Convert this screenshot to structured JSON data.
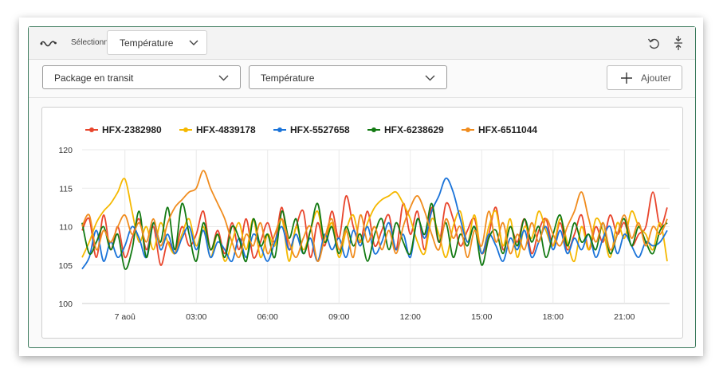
{
  "toolbar": {
    "select_label": "Sélectionner",
    "metric_value": "Température",
    "icons": [
      "wave-icon",
      "chevron-down-icon",
      "undo-icon",
      "collapse-icon"
    ]
  },
  "filters": {
    "package_value": "Package en transit",
    "metric_value": "Température",
    "add_label": "Ajouter"
  },
  "colors": {
    "panel_border": "#3b7a5c",
    "series": [
      "#e8452c",
      "#f5b800",
      "#1a73d9",
      "#137a13",
      "#f08c1e"
    ]
  },
  "chart_data": {
    "type": "line",
    "x_ticks": [
      "7 aoû",
      "03:00",
      "06:00",
      "09:00",
      "12:00",
      "15:00",
      "18:00",
      "21:00"
    ],
    "y_ticks": [
      "120",
      "115",
      "110",
      "105",
      "100"
    ],
    "ylim": [
      100,
      120
    ],
    "xlim": [
      -1.8,
      22.9
    ],
    "grid": true,
    "legend_position": "top-left",
    "series": [
      {
        "name": "HFX-2382980",
        "color": "#e8452c",
        "x": [
          -1.8,
          -1.5,
          -1.2,
          -0.9,
          -0.6,
          -0.3,
          0,
          0.3,
          0.6,
          0.9,
          1.2,
          1.5,
          1.8,
          2.1,
          2.4,
          2.7,
          3,
          3.3,
          3.6,
          3.9,
          4.2,
          4.5,
          4.8,
          5.1,
          5.4,
          5.7,
          6,
          6.3,
          6.6,
          6.9,
          7.2,
          7.5,
          7.8,
          8.1,
          8.4,
          8.7,
          9,
          9.3,
          9.6,
          9.9,
          10.2,
          10.5,
          10.8,
          11.1,
          11.4,
          11.7,
          12,
          12.3,
          12.6,
          12.9,
          13.2,
          13.5,
          13.8,
          14.1,
          14.4,
          14.7,
          15,
          15.3,
          15.6,
          15.9,
          16.2,
          16.5,
          16.8,
          17.1,
          17.4,
          17.7,
          18,
          18.3,
          18.6,
          18.9,
          19.2,
          19.5,
          19.8,
          20.1,
          20.4,
          20.7,
          21,
          21.3,
          21.6,
          21.9,
          22.2,
          22.5,
          22.8
        ],
        "y": [
          109.5,
          111,
          106,
          111.5,
          107,
          110,
          106,
          108.5,
          111,
          107,
          110,
          105,
          108,
          106.5,
          110,
          107.5,
          109,
          112,
          107,
          109.5,
          106.5,
          110.5,
          107,
          111,
          106,
          108,
          110.5,
          108,
          112.5,
          107,
          110,
          112,
          106,
          110.5,
          107.5,
          112,
          108.5,
          114,
          110,
          108,
          112,
          107.5,
          109.5,
          111.5,
          107,
          113,
          109,
          112,
          107,
          112.5,
          108,
          113,
          111,
          107.5,
          109.5,
          111,
          106.5,
          109,
          112.5,
          107,
          110,
          108,
          111,
          106.5,
          109.5,
          111,
          107.5,
          110.5,
          107,
          109,
          111.5,
          107,
          110,
          108,
          111.5,
          109,
          110.5,
          107.5,
          109,
          110,
          114.5,
          110,
          112.5
        ]
      },
      {
        "name": "HFX-4839178",
        "color": "#f5b800",
        "x": [
          -1.8,
          -1.5,
          -1.2,
          -0.9,
          -0.6,
          -0.3,
          0,
          0.3,
          0.6,
          0.9,
          1.2,
          1.5,
          1.8,
          2.1,
          2.4,
          2.7,
          3,
          3.3,
          3.6,
          3.9,
          4.2,
          4.5,
          4.8,
          5.1,
          5.4,
          5.7,
          6,
          6.3,
          6.6,
          6.9,
          7.2,
          7.5,
          7.8,
          8.1,
          8.4,
          8.7,
          9,
          9.3,
          9.6,
          9.9,
          10.2,
          10.5,
          10.8,
          11.1,
          11.4,
          11.7,
          12,
          12.3,
          12.6,
          12.9,
          13.2,
          13.5,
          13.8,
          14.1,
          14.4,
          14.7,
          15,
          15.3,
          15.6,
          15.9,
          16.2,
          16.5,
          16.8,
          17.1,
          17.4,
          17.7,
          18,
          18.3,
          18.6,
          18.9,
          19.2,
          19.5,
          19.8,
          20.1,
          20.4,
          20.7,
          21,
          21.3,
          21.6,
          21.9,
          22.2,
          22.5,
          22.8
        ],
        "y": [
          106,
          108,
          110.5,
          112,
          113,
          114.5,
          116.2,
          112,
          108,
          110,
          107,
          110.5,
          108,
          106.5,
          109,
          111,
          107.5,
          110,
          106,
          109,
          105.5,
          108,
          110.5,
          107,
          111,
          106,
          109,
          107.5,
          111,
          105.5,
          110,
          107,
          109.5,
          112,
          108,
          110.5,
          106,
          109.5,
          111.5,
          108,
          110.5,
          112.5,
          113.5,
          114,
          114.5,
          113,
          111,
          108,
          106.5,
          111,
          109,
          106,
          110,
          112,
          108,
          111.5,
          106.5,
          110,
          112,
          107.5,
          111,
          106,
          110,
          108.5,
          112,
          109.5,
          107.5,
          111,
          108,
          105.5,
          110,
          107,
          111,
          109.5,
          106,
          110.5,
          108.5,
          112,
          110,
          109,
          107,
          110.5,
          105.5
        ]
      },
      {
        "name": "HFX-5527658",
        "color": "#1a73d9",
        "x": [
          -1.8,
          -1.5,
          -1.2,
          -0.9,
          -0.6,
          -0.3,
          0,
          0.3,
          0.6,
          0.9,
          1.2,
          1.5,
          1.8,
          2.1,
          2.4,
          2.7,
          3,
          3.3,
          3.6,
          3.9,
          4.2,
          4.5,
          4.8,
          5.1,
          5.4,
          5.7,
          6,
          6.3,
          6.6,
          6.9,
          7.2,
          7.5,
          7.8,
          8.1,
          8.4,
          8.7,
          9,
          9.3,
          9.6,
          9.9,
          10.2,
          10.5,
          10.8,
          11.1,
          11.4,
          11.7,
          12,
          12.3,
          12.6,
          12.9,
          13.2,
          13.5,
          13.8,
          14.1,
          14.4,
          14.7,
          15,
          15.3,
          15.6,
          15.9,
          16.2,
          16.5,
          16.8,
          17.1,
          17.4,
          17.7,
          18,
          18.3,
          18.6,
          18.9,
          19.2,
          19.5,
          19.8,
          20.1,
          20.4,
          20.7,
          21,
          21.3,
          21.6,
          21.9,
          22.2,
          22.5,
          22.8
        ],
        "y": [
          104.5,
          106,
          109.5,
          105.5,
          108,
          106,
          107.5,
          110,
          108.5,
          106,
          110.5,
          107,
          109,
          106.5,
          108.5,
          110,
          107,
          109.5,
          106,
          108,
          107,
          105.5,
          108.5,
          106,
          109,
          107.5,
          105.5,
          108,
          110,
          107,
          109,
          106.5,
          108.5,
          105.5,
          109,
          107,
          108.5,
          106,
          109.5,
          107.5,
          110,
          106.5,
          108,
          110.5,
          107,
          109,
          106,
          111,
          108.5,
          112,
          114,
          116.3,
          114.5,
          111,
          108,
          110,
          106.5,
          109,
          107.5,
          105.5,
          108.5,
          107,
          109.5,
          106,
          108,
          110,
          107,
          109.5,
          106.5,
          108.5,
          107,
          109,
          106,
          108.5,
          110,
          106.5,
          109,
          107.5,
          106,
          108,
          107.5,
          108,
          109.5
        ]
      },
      {
        "name": "HFX-6238629",
        "color": "#137a13",
        "x": [
          -1.8,
          -1.5,
          -1.2,
          -0.9,
          -0.6,
          -0.3,
          0,
          0.3,
          0.6,
          0.9,
          1.2,
          1.5,
          1.8,
          2.1,
          2.4,
          2.7,
          3,
          3.3,
          3.6,
          3.9,
          4.2,
          4.5,
          4.8,
          5.1,
          5.4,
          5.7,
          6,
          6.3,
          6.6,
          6.9,
          7.2,
          7.5,
          7.8,
          8.1,
          8.4,
          8.7,
          9,
          9.3,
          9.6,
          9.9,
          10.2,
          10.5,
          10.8,
          11.1,
          11.4,
          11.7,
          12,
          12.3,
          12.6,
          12.9,
          13.2,
          13.5,
          13.8,
          14.1,
          14.4,
          14.7,
          15,
          15.3,
          15.6,
          15.9,
          16.2,
          16.5,
          16.8,
          17.1,
          17.4,
          17.7,
          18,
          18.3,
          18.6,
          18.9,
          19.2,
          19.5,
          19.8,
          20.1,
          20.4,
          20.7,
          21,
          21.3,
          21.6,
          21.9,
          22.2,
          22.5,
          22.8
        ],
        "y": [
          110.5,
          106.5,
          108,
          110,
          107,
          109,
          104.5,
          107,
          112,
          106,
          110.5,
          108,
          112.5,
          107,
          113,
          109,
          105.5,
          110.5,
          107,
          109,
          106,
          110,
          108.5,
          105.5,
          111,
          107.5,
          109,
          106,
          112,
          108.5,
          111,
          106.5,
          109.5,
          113,
          108,
          110,
          106.5,
          110,
          107.5,
          109,
          105.5,
          109,
          111,
          107,
          110.5,
          108,
          106.5,
          111,
          109,
          113,
          108,
          110.5,
          106,
          109,
          107.5,
          110,
          105,
          108.5,
          109.5,
          106.5,
          110,
          107.5,
          111,
          108,
          110,
          106,
          109,
          111.5,
          107.5,
          110.5,
          108,
          109,
          107,
          110.5,
          106.5,
          109,
          111,
          107.5,
          110,
          108,
          106.5,
          109.5,
          110.5
        ]
      },
      {
        "name": "HFX-6511044",
        "color": "#f08c1e",
        "x": [
          -1.8,
          -1.5,
          -1.2,
          -0.9,
          -0.6,
          -0.3,
          0,
          0.3,
          0.6,
          0.9,
          1.2,
          1.5,
          1.8,
          2.1,
          2.4,
          2.7,
          3,
          3.3,
          3.6,
          3.9,
          4.2,
          4.5,
          4.8,
          5.1,
          5.4,
          5.7,
          6,
          6.3,
          6.6,
          6.9,
          7.2,
          7.5,
          7.8,
          8.1,
          8.4,
          8.7,
          9,
          9.3,
          9.6,
          9.9,
          10.2,
          10.5,
          10.8,
          11.1,
          11.4,
          11.7,
          12,
          12.3,
          12.6,
          12.9,
          13.2,
          13.5,
          13.8,
          14.1,
          14.4,
          14.7,
          15,
          15.3,
          15.6,
          15.9,
          16.2,
          16.5,
          16.8,
          17.1,
          17.4,
          17.7,
          18,
          18.3,
          18.6,
          18.9,
          19.2,
          19.5,
          19.8,
          20.1,
          20.4,
          20.7,
          21,
          21.3,
          21.6,
          21.9,
          22.2,
          22.5,
          22.8
        ],
        "y": [
          110,
          111.5,
          107,
          109.5,
          108,
          110,
          111.5,
          109,
          110.5,
          108,
          111,
          107.5,
          110.5,
          112.5,
          113.5,
          114.5,
          115,
          117.3,
          115,
          113,
          111,
          108,
          106,
          109,
          107.5,
          110.5,
          106.5,
          109,
          111,
          108,
          106,
          108.5,
          110,
          105.5,
          108.5,
          111,
          107,
          109.5,
          106,
          111.5,
          108,
          110,
          107,
          109.5,
          106.5,
          110,
          112.5,
          114,
          112,
          109,
          107,
          111,
          108.5,
          110,
          106,
          109.5,
          107.5,
          112,
          108,
          110.5,
          106.5,
          109,
          107,
          110.5,
          108,
          111,
          109,
          107.5,
          110,
          112,
          114.5,
          111,
          108,
          110.5,
          107,
          109,
          111.5,
          108.5,
          110.5,
          107.5,
          110,
          109,
          111
        ]
      }
    ]
  }
}
